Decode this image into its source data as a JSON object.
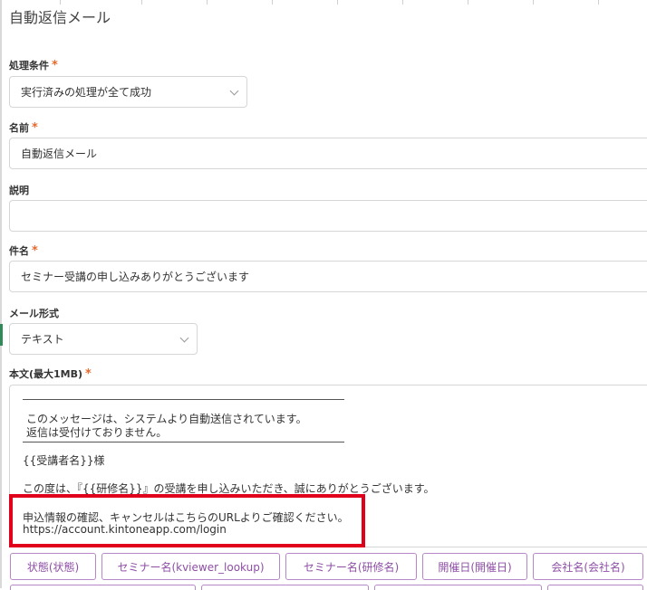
{
  "page": {
    "title": "自動返信メール"
  },
  "fields": {
    "condition": {
      "label": "処理条件",
      "required": "*",
      "value": "実行済みの処理が全て成功"
    },
    "name": {
      "label": "名前",
      "required": "*",
      "value": "自動返信メール"
    },
    "description": {
      "label": "説明",
      "value": ""
    },
    "subject": {
      "label": "件名",
      "required": "*",
      "value": "セミナー受講の申し込みありがとうございます"
    },
    "mail_format": {
      "label": "メール形式",
      "value": "テキスト"
    },
    "body": {
      "label": "本文(最大1MB)",
      "required": "*",
      "lines": [
        "このメッセージは、システムより自動送信されています。",
        "返信は受付けておりません。",
        "{{受講者名}}様",
        "この度は、『{{研修名}}』の受講を申し込みいただき、誠にありがとうございます。",
        "申込情報の確認、キャンセルはこちらのURLよりご確認ください。",
        "https://account.kintoneapp.com/login"
      ]
    }
  },
  "field_chips": [
    "状態(状態)",
    "セミナー名(kviewer_lookup)",
    "セミナー名(研修名)",
    "開催日(開催日)",
    "会社名(会社名)"
  ],
  "colors": {
    "required": "#e8692d",
    "chip": "#8e4fa6",
    "highlight": "#e0001b"
  }
}
